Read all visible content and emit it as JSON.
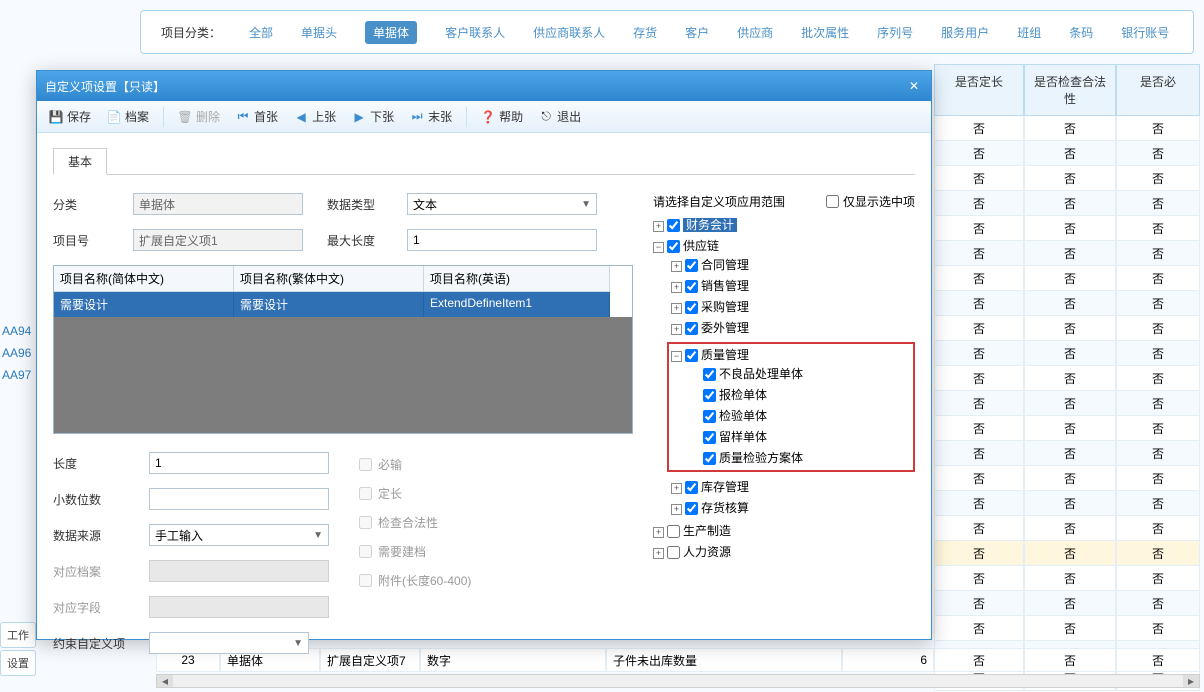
{
  "filter": {
    "label": "项目分类：",
    "items": [
      "全部",
      "单据头",
      "单据体",
      "客户联系人",
      "供应商联系人",
      "存货",
      "客户",
      "供应商",
      "批次属性",
      "序列号",
      "服务用户",
      "班组",
      "条码",
      "银行账号"
    ],
    "active_index": 2
  },
  "bg_table": {
    "headers": [
      "是否定长",
      "是否检查合法性",
      "是否必"
    ],
    "cell": "否",
    "row_count": 23,
    "highlight_row": 17
  },
  "bottom_row": {
    "c0": "23",
    "c1": "单据体",
    "c2": "扩展自定义项7",
    "c3": "数字",
    "c4": "",
    "c5": "子件未出库数量",
    "c6": "6",
    "c7": "否",
    "c8": "否",
    "c9": "否"
  },
  "side_links": [
    "AA94",
    "AA96",
    "AA97"
  ],
  "side_tabs": [
    "工作",
    "设置"
  ],
  "dialog": {
    "title": "自定义项设置【只读】",
    "toolbar": {
      "save": "保存",
      "archive": "档案",
      "delete": "删除",
      "first": "首张",
      "prev": "上张",
      "next": "下张",
      "last": "末张",
      "help": "帮助",
      "exit": "退出"
    },
    "tab_basic": "基本",
    "labels": {
      "category": "分类",
      "data_type": "数据类型",
      "item_no": "项目号",
      "max_len": "最大长度",
      "length": "长度",
      "decimals": "小数位数",
      "data_src": "数据来源",
      "ref_archive": "对应档案",
      "ref_field": "对应字段",
      "constraint": "约束自定义项",
      "required": "必输",
      "fixed_len": "定长",
      "check_valid": "检查合法性",
      "need_archive": "需要建档",
      "attachment": "附件(长度60-400)"
    },
    "values": {
      "category": "单据体",
      "data_type": "文本",
      "item_no": "扩展自定义项1",
      "max_len": "1",
      "length": "1",
      "decimals": "",
      "data_src": "手工输入",
      "ref_archive": "",
      "ref_field": "",
      "constraint": ""
    },
    "names_table": {
      "h1": "项目名称(简体中文)",
      "h2": "项目名称(繁体中文)",
      "h3": "项目名称(英语)",
      "r1": "需要设计",
      "r2": "需要设计",
      "r3": "ExtendDefineItem1"
    },
    "right": {
      "title": "请选择自定义项应用范围",
      "only_selected": "仅显示选中项",
      "tree": {
        "finance": "财务会计",
        "supply": "供应链",
        "contract": "合同管理",
        "sales": "销售管理",
        "purchase": "采购管理",
        "outsource": "委外管理",
        "quality": "质量管理",
        "q1": "不良品处理单体",
        "q2": "报检单体",
        "q3": "检验单体",
        "q4": "留样单体",
        "q5": "质量检验方案体",
        "inventory": "库存管理",
        "stock_calc": "存货核算",
        "production": "生产制造",
        "hr": "人力资源"
      }
    }
  }
}
